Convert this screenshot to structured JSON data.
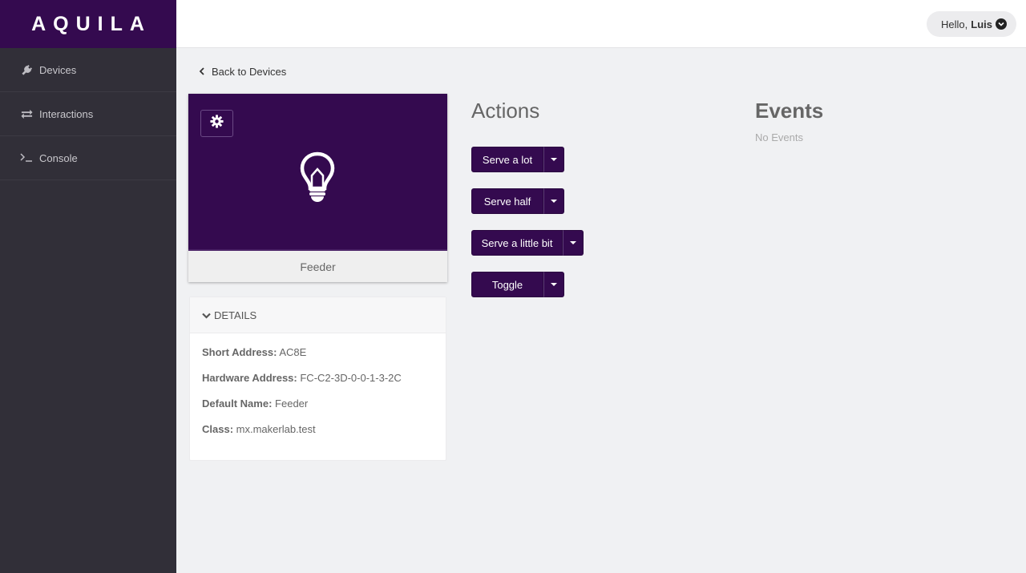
{
  "app": {
    "logo": "AQUILA"
  },
  "sidebar": {
    "items": [
      {
        "label": "Devices",
        "icon": "plug-icon"
      },
      {
        "label": "Interactions",
        "icon": "exchange-icon"
      },
      {
        "label": "Console",
        "icon": "terminal-icon"
      }
    ]
  },
  "header": {
    "greeting": "Hello,",
    "username": "Luis"
  },
  "back_link": "Back to Devices",
  "device": {
    "name": "Feeder",
    "icon": "lightbulb-icon"
  },
  "details": {
    "heading": "DETAILS",
    "rows": [
      {
        "key": "Short Address:",
        "value": "AC8E"
      },
      {
        "key": "Hardware Address:",
        "value": "FC-C2-3D-0-0-1-3-2C"
      },
      {
        "key": "Default Name:",
        "value": "Feeder"
      },
      {
        "key": "Class:",
        "value": "mx.makerlab.test"
      }
    ]
  },
  "actions": {
    "title": "Actions",
    "buttons": [
      {
        "label": "Serve a lot"
      },
      {
        "label": "Serve half"
      },
      {
        "label": "Serve a little bit"
      },
      {
        "label": "Toggle"
      }
    ]
  },
  "events": {
    "title": "Events",
    "empty_text": "No Events"
  },
  "colors": {
    "brand": "#340a4f",
    "sidebar": "#312f38",
    "background": "#f0f1f3"
  }
}
